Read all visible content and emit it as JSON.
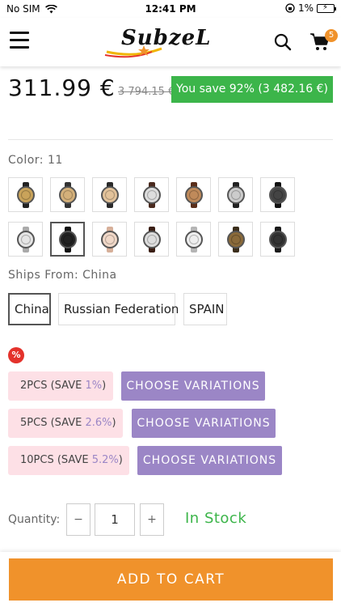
{
  "status_bar": {
    "carrier": "No SIM",
    "time": "12:41 PM",
    "battery": "1%"
  },
  "header": {
    "logo_text": "SubzeL",
    "cart_count": "5"
  },
  "product": {
    "price": "311.99 €",
    "old_price": "3 794.15 €",
    "save_text": "You save 92% (3 482.16 €)"
  },
  "color": {
    "label": "Color:",
    "value": "11",
    "swatches": [
      {
        "strap": "#222",
        "dial": "#c9a35a"
      },
      {
        "strap": "#333",
        "dial": "#d4b07a"
      },
      {
        "strap": "#2a2a2a",
        "dial": "#e2c29a"
      },
      {
        "strap": "#4a2a1e",
        "dial": "#ddd"
      },
      {
        "strap": "#5a2e1a",
        "dial": "#c08a5a"
      },
      {
        "strap": "#222",
        "dial": "#ccc"
      },
      {
        "strap": "#111",
        "dial": "#444"
      },
      {
        "strap": "#aaa",
        "dial": "#e5e5e5"
      },
      {
        "strap": "#111",
        "dial": "#222"
      },
      {
        "strap": "#d7b09a",
        "dial": "#f0d8c8"
      },
      {
        "strap": "#3a1e14",
        "dial": "#ddd"
      },
      {
        "strap": "#b5b5b5",
        "dial": "#eee"
      },
      {
        "strap": "#3b2e1c",
        "dial": "#8a6a3a"
      },
      {
        "strap": "#1a1a1a",
        "dial": "#333"
      }
    ]
  },
  "ships_from": {
    "label": "Ships From:",
    "value": "China",
    "options": [
      "China",
      "Russian Federation",
      "SPAIN"
    ]
  },
  "discount_icon": "%",
  "bundles": [
    {
      "prefix": "2PCS (SAVE ",
      "pct": "1%",
      "suffix": ")",
      "button": "CHOOSE VARIATIONS"
    },
    {
      "prefix": "5PCS (SAVE ",
      "pct": "2.6%",
      "suffix": ")",
      "button": "CHOOSE VARIATIONS"
    },
    {
      "prefix": "10PCS (SAVE ",
      "pct": "5.2%",
      "suffix": ")",
      "button": "CHOOSE VARIATIONS"
    }
  ],
  "quantity": {
    "label": "Quantity:",
    "minus": "−",
    "value": "1",
    "plus": "+",
    "stock": "In Stock"
  },
  "add_to_cart": "ADD TO CART",
  "colors": {
    "accent": "#f0922b",
    "green": "#3cb54a",
    "purple": "#9b86c6",
    "pink": "#fde0e6"
  }
}
